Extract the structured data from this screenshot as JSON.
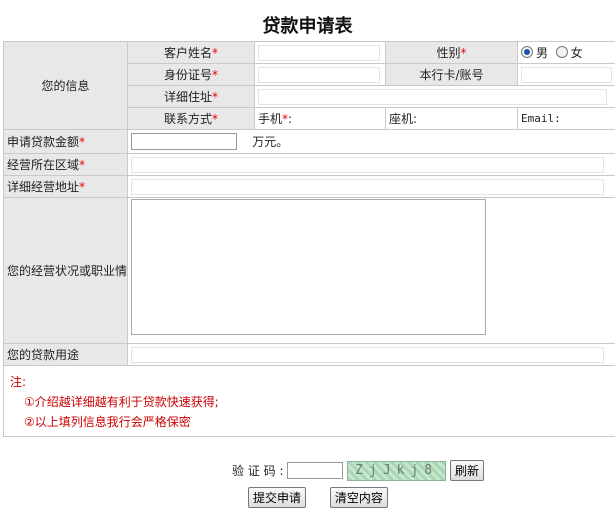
{
  "title": "贷款申请表",
  "section_label": "您的信息",
  "fields": {
    "customer_name": "客户姓名",
    "gender": "性别",
    "gender_options": [
      "男",
      "女"
    ],
    "id_number": "身份证号",
    "bank_card": "本行卡/账号",
    "address": "详细住址",
    "contact": "联系方式",
    "mobile": "手机",
    "landline": "座机:",
    "email": "Email:",
    "loan_amount": "申请贷款金额",
    "amount_unit": "万元。",
    "business_area": "经营所在区域",
    "business_address": "详细经营地址",
    "business_status": "您的经营状况或职业情况",
    "loan_purpose": "您的贷款用途"
  },
  "required_mark": "*",
  "colon": ":",
  "note": {
    "label": "注:",
    "items": [
      "①介绍越详细越有利于贷款快速获得;",
      "②以上填列信息我行会严格保密"
    ]
  },
  "captcha": {
    "label": "验 证 码 :",
    "image_text": "ZjJkj8",
    "refresh": "刷新"
  },
  "buttons": {
    "submit": "提交申请",
    "clear": "清空内容"
  }
}
